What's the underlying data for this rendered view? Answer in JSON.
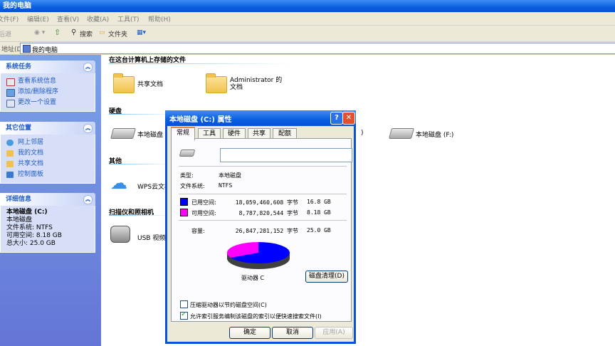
{
  "window": {
    "title": "我的电脑"
  },
  "menubar": {
    "items": [
      "文件(F)",
      "编辑(E)",
      "查看(V)",
      "收藏(A)",
      "工具(T)",
      "帮助(H)"
    ]
  },
  "toolbar": {
    "back": "后退",
    "search": "搜索",
    "folders": "文件夹"
  },
  "address": {
    "label": "地址(D)",
    "value": "我的电脑"
  },
  "sidebar": {
    "system_tasks": {
      "title": "系统任务",
      "items": [
        "查看系统信息",
        "添加/删除程序",
        "更改一个设置"
      ]
    },
    "other_places": {
      "title": "其它位置",
      "items": [
        "网上邻居",
        "我的文档",
        "共享文档",
        "控制面板"
      ]
    },
    "details": {
      "title": "详细信息",
      "name": "本地磁盘 (C:)",
      "type": "本地磁盘",
      "filesystem": "文件系统: NTFS",
      "free": "可用空间: 8.18 GB",
      "total": "总大小: 25.0 GB"
    }
  },
  "main": {
    "stored_files_header": "在这台计算机上存储的文件",
    "shared_docs": "共享文档",
    "admin_docs": "Administrator 的文档",
    "hdd_header": "硬盘",
    "drive_c": "本地磁盘",
    "drive_paren": ")",
    "drive_f": "本地磁盘 (F:)",
    "other_header": "其他",
    "cloud": "WPS云文档",
    "scanners_header": "扫描仪和照相机",
    "usb_camera": "USB 视频设"
  },
  "dialog": {
    "title": "本地磁盘 (C:) 属性",
    "tabs": [
      "常规",
      "工具",
      "硬件",
      "共享",
      "配额"
    ],
    "active_tab": 0,
    "volume_label": "",
    "type_label": "类型:",
    "type_value": "本地磁盘",
    "fs_label": "文件系统:",
    "fs_value": "NTFS",
    "used_label": "已用空间:",
    "used_bytes": "18,059,460,608 字节",
    "used_gb": "16.8 GB",
    "free_label": "可用空间:",
    "free_bytes": "8,787,820,544 字节",
    "free_gb": "8.18 GB",
    "capacity_label": "容量:",
    "capacity_bytes": "26,847,281,152 字节",
    "capacity_gb": "25.0 GB",
    "drive_label": "驱动器 C",
    "cleanup_button": "磁盘清理(D)",
    "compress_label": "压缩驱动器以节约磁盘空间(C)",
    "compress_checked": false,
    "index_label": "允许索引服务编制该磁盘的索引以便快速搜索文件(I)",
    "index_checked": true,
    "ok": "确定",
    "cancel": "取消",
    "apply": "应用(A)",
    "colors": {
      "used": "#0000ff",
      "free": "#ff00ff"
    },
    "used_fraction": 0.673
  }
}
